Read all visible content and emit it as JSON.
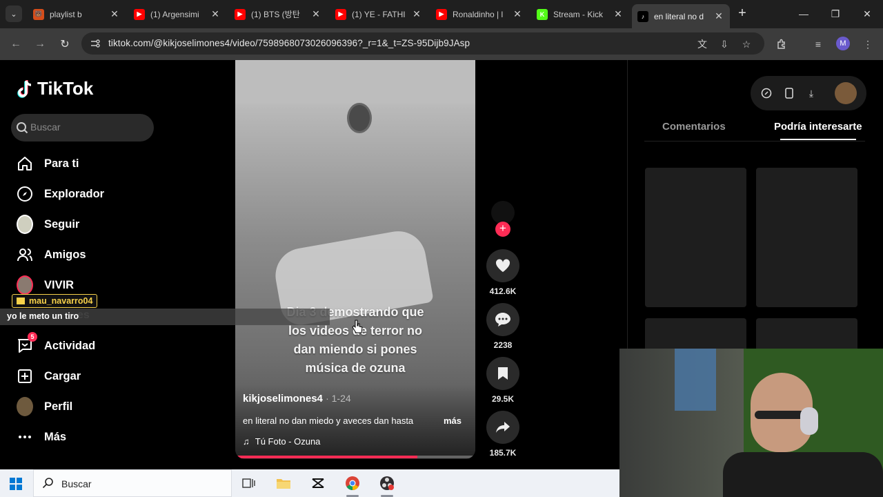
{
  "browser": {
    "tabs": [
      {
        "title": "playlist b",
        "fav_color": "#d64d1a",
        "fav_glyph": "🐻",
        "active": false
      },
      {
        "title": "(1) Argensimi",
        "fav_color": "#ff0000",
        "fav_glyph": "▶",
        "active": false
      },
      {
        "title": "(1) BTS (방탄",
        "fav_color": "#ff0000",
        "fav_glyph": "▶",
        "active": false
      },
      {
        "title": "(1) YE - FATHI",
        "fav_color": "#ff0000",
        "fav_glyph": "▶",
        "active": false
      },
      {
        "title": "Ronaldinho | l",
        "fav_color": "#ff0000",
        "fav_glyph": "▶",
        "active": false
      },
      {
        "title": "Stream - Kick",
        "fav_color": "#53fc18",
        "fav_glyph": "K",
        "active": false
      },
      {
        "title": "en literal no d",
        "fav_color": "#000000",
        "fav_glyph": "♪",
        "active": true
      }
    ],
    "url": "tiktok.com/@kikjoselimones4/video/7598968073026096396?_r=1&_t=ZS-95Dijb9JAsp",
    "profile_initial": "M"
  },
  "sidebar": {
    "brand": "TikTok",
    "search_placeholder": "Buscar",
    "items": [
      {
        "label": "Para ti",
        "icon": "home-icon"
      },
      {
        "label": "Explorador",
        "icon": "compass-icon"
      },
      {
        "label": "Seguir",
        "icon": "following-avatar-icon"
      },
      {
        "label": "Amigos",
        "icon": "friends-icon"
      },
      {
        "label": "VIVIR",
        "icon": "live-avatar-icon"
      },
      {
        "label": "Actividad",
        "icon": "inbox-icon",
        "badge": "5"
      },
      {
        "label": "Cargar",
        "icon": "upload-icon"
      },
      {
        "label": "Perfil",
        "icon": "profile-avatar-icon"
      },
      {
        "label": "Más",
        "icon": "more-icon"
      }
    ],
    "hidden_item_fragment": "es"
  },
  "overlay_chat": {
    "username": "mau_navarro04",
    "message": "yo le meto un tiro"
  },
  "video": {
    "caption": "Dia 3 demostrando que los videos de terror no dan miendo si pones música de ozuna",
    "author": "kikjoselimones4",
    "date": "· 1-24",
    "description": "en literal no dan miedo y aveces dan hasta",
    "more_label": "más",
    "music": "Tú Foto - Ozuna",
    "progress": 0.76
  },
  "actions": {
    "likes": "412.6K",
    "comments": "2238",
    "saves": "29.5K",
    "shares": "185.7K"
  },
  "right_panel": {
    "tabs": [
      "Comentarios",
      "Podría interesarte"
    ],
    "active_tab": 1
  },
  "taskbar": {
    "search_placeholder": "Buscar"
  },
  "colors": {
    "accent": "#fe2c55",
    "chat_user": "#f7d14a"
  }
}
